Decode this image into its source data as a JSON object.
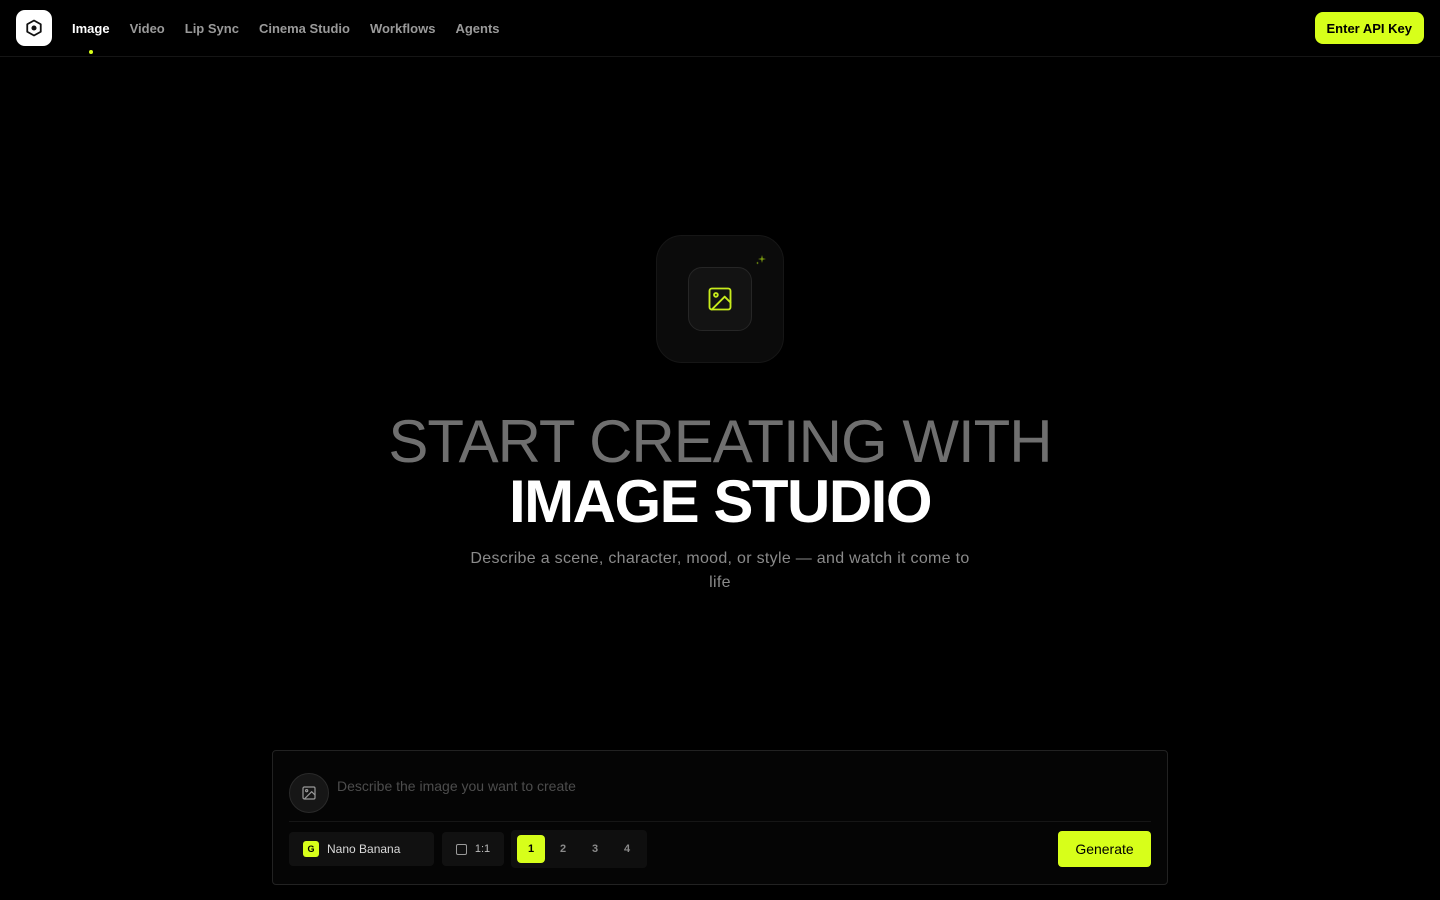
{
  "app": {
    "logo_icon": "hexagon-camera-icon"
  },
  "nav": {
    "items": [
      {
        "label": "Image",
        "active": true
      },
      {
        "label": "Video",
        "active": false
      },
      {
        "label": "Lip Sync",
        "active": false
      },
      {
        "label": "Cinema Studio",
        "active": false
      },
      {
        "label": "Workflows",
        "active": false
      },
      {
        "label": "Agents",
        "active": false
      }
    ],
    "api_key_label": "Enter API Key"
  },
  "hero": {
    "icon": "image-icon",
    "sparkle_icon": "sparkle-icon",
    "title_line1": "START CREATING WITH",
    "title_line2": "IMAGE STUDIO",
    "subtitle": "Describe a scene, character, mood, or style — and watch it come to life"
  },
  "composer": {
    "attach_icon": "image-icon",
    "placeholder": "Describe the image you want to create",
    "value": "",
    "model": {
      "badge": "G",
      "label": "Nano Banana"
    },
    "aspect_ratio": "1:1",
    "counts": [
      "1",
      "2",
      "3",
      "4"
    ],
    "selected_count": "1",
    "generate_label": "Generate"
  },
  "colors": {
    "accent": "#d7ff1a",
    "background": "#000000",
    "muted_text": "#8a8a8a"
  }
}
